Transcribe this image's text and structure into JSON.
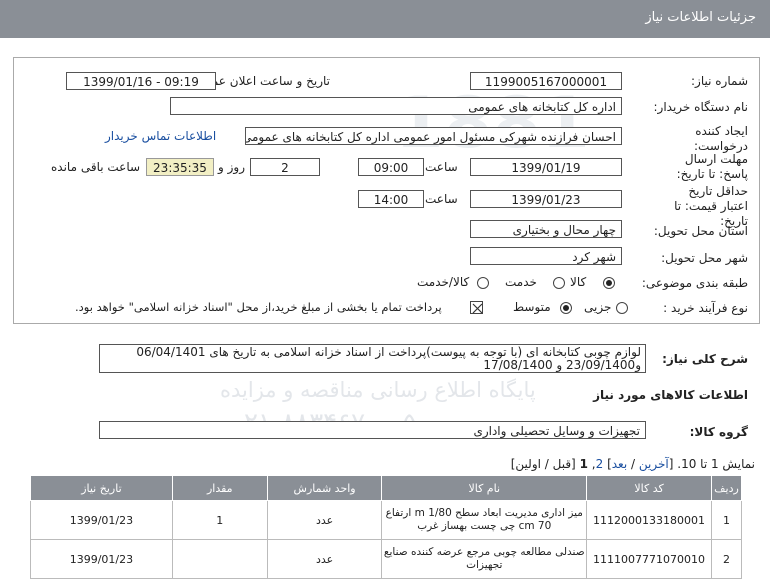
{
  "header": {
    "title": "جزئیات اطلاعات نیاز"
  },
  "watermark": {
    "lines": [
      "پایگاه اطلاع رسانی مناقصه و مزایده",
      "۰۲۱-۸۸۳۴۶۷۰۰-۵"
    ]
  },
  "form": {
    "need_number_label": "شماره نیاز:",
    "need_number": "1199005167000001",
    "announce_label": "تاریخ و ساعت اعلان عمومی:",
    "announce_value": "1399/01/16 - 09:19",
    "buyer_org_label": "نام دستگاه خریدار:",
    "buyer_org": "اداره کل کتابخانه های عمومی",
    "creator_label": "ایجاد کننده درخواست:",
    "creator": "احسان فرازنده شهرکی مسئول امور عمومی اداره کل کتابخانه های عمومی",
    "buyer_contact_link": "اطلاعات تماس خریدار",
    "reply_deadline_label": "مهلت ارسال پاسخ: تا تاریخ:",
    "reply_date": "1399/01/19",
    "time_label": "ساعت",
    "reply_time": "09:00",
    "days_value": "2",
    "days_label": "روز و",
    "remaining_time": "23:35:35",
    "remaining_label": "ساعت باقی مانده",
    "validity_label": "حداقل تاریخ اعتبار قیمت: تا تاریخ:",
    "validity_date": "1399/01/23",
    "validity_time": "14:00",
    "province_label": "استان محل تحویل:",
    "province": "چهار محال و بختیاری",
    "city_label": "شهر محل تحویل:",
    "city": "شهر کرد",
    "category_label": "طبقه بندی موضوعی:",
    "category_options": [
      {
        "label": "کالا",
        "selected": true
      },
      {
        "label": "خدمت",
        "selected": false
      },
      {
        "label": "کالا/خدمت",
        "selected": false
      }
    ],
    "process_label": "نوع فرآیند خرید :",
    "process_options": [
      {
        "label": "جزیی",
        "selected": false
      },
      {
        "label": "متوسط",
        "selected": true
      }
    ],
    "payment_note": "پرداخت تمام یا بخشی از مبلغ خرید،از محل \"اسناد خزانه اسلامی\" خواهد بود."
  },
  "description": {
    "label": "شرح کلی نیاز:",
    "line1": "لوازم چوبی کتابخانه ای (با توجه به پیوست)پرداخت از اسناد خزانه اسلامی به تاریخ های 06/04/1401",
    "line2": "و23/09/1400 و 17/08/1400"
  },
  "goods_title": "اطلاعات کالاهای مورد نیاز",
  "goods_group": {
    "label": "گروه کالا:",
    "value": "تجهیزات و وسایل تحصیلی واداری"
  },
  "pagination": {
    "prefix": "نمایش 1 تا 10.",
    "last": "آخرین",
    "next": "بعد",
    "page2": "2",
    "page1": "1",
    "rest": "[قبل / اولین]"
  },
  "table": {
    "headers": [
      "ردیف",
      "کد کالا",
      "نام کالا",
      "واحد شمارش",
      "مقدار",
      "تاریخ نیاز"
    ],
    "rows": [
      {
        "idx": "1",
        "code": "1112000133180001",
        "name": "میز اداری مدیریت ابعاد سطح m 1/80 ارتفاع cm 70 چی چست بهساز غرب",
        "unit": "عدد",
        "qty": "1",
        "date": "1399/01/23"
      },
      {
        "idx": "2",
        "code": "1111007771070010",
        "name": "صندلی مطالعه چوبی مرجع عرضه کننده صنایع تجهیزات",
        "unit": "عدد",
        "qty": "",
        "date": "1399/01/23"
      }
    ]
  }
}
